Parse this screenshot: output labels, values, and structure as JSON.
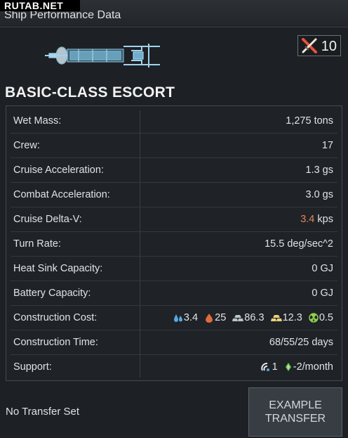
{
  "watermark": "RUTAB.NET",
  "header": {
    "title": "Ship Performance Data"
  },
  "combat": {
    "value": "10",
    "icon": "crossed-swords-icon"
  },
  "ship": {
    "class_name": "BASIC-CLASS ESCORT"
  },
  "stats": [
    {
      "label": "Wet Mass:",
      "value": "1,275 tons"
    },
    {
      "label": "Crew:",
      "value": "17"
    },
    {
      "label": "Cruise Acceleration:",
      "value": "1.3 gs"
    },
    {
      "label": "Combat Acceleration:",
      "value": "3.0 gs"
    },
    {
      "label": "Cruise Delta-V:",
      "value": "3.4",
      "unit": "kps",
      "value_color": "#e0875a"
    },
    {
      "label": "Turn Rate:",
      "value": "15.5 deg/sec^2"
    },
    {
      "label": "Heat Sink Capacity:",
      "value": "0 GJ"
    },
    {
      "label": "Battery Capacity:",
      "value": "0 GJ"
    },
    {
      "label": "Construction Cost:",
      "resources": [
        {
          "icon": "water-icon",
          "value": "3.4",
          "color": "#5aa7e0"
        },
        {
          "icon": "volatiles-icon",
          "value": "25",
          "color": "#e06a3c"
        },
        {
          "icon": "metals-icon",
          "value": "86.3",
          "color": "#b8c4cc"
        },
        {
          "icon": "noble-metals-icon",
          "value": "12.3",
          "color": "#e8d07a"
        },
        {
          "icon": "fissiles-icon",
          "value": "0.5",
          "color": "#8fd14f"
        }
      ]
    },
    {
      "label": "Construction Time:",
      "value": "68/55/25 days"
    },
    {
      "label": "Support:",
      "support": [
        {
          "icon": "mission-control-icon",
          "value": "1"
        },
        {
          "icon": "money-icon",
          "value": "-2/month"
        }
      ]
    }
  ],
  "transfer": {
    "status": "No Transfer Set",
    "button_label": "EXAMPLE TRANSFER"
  }
}
